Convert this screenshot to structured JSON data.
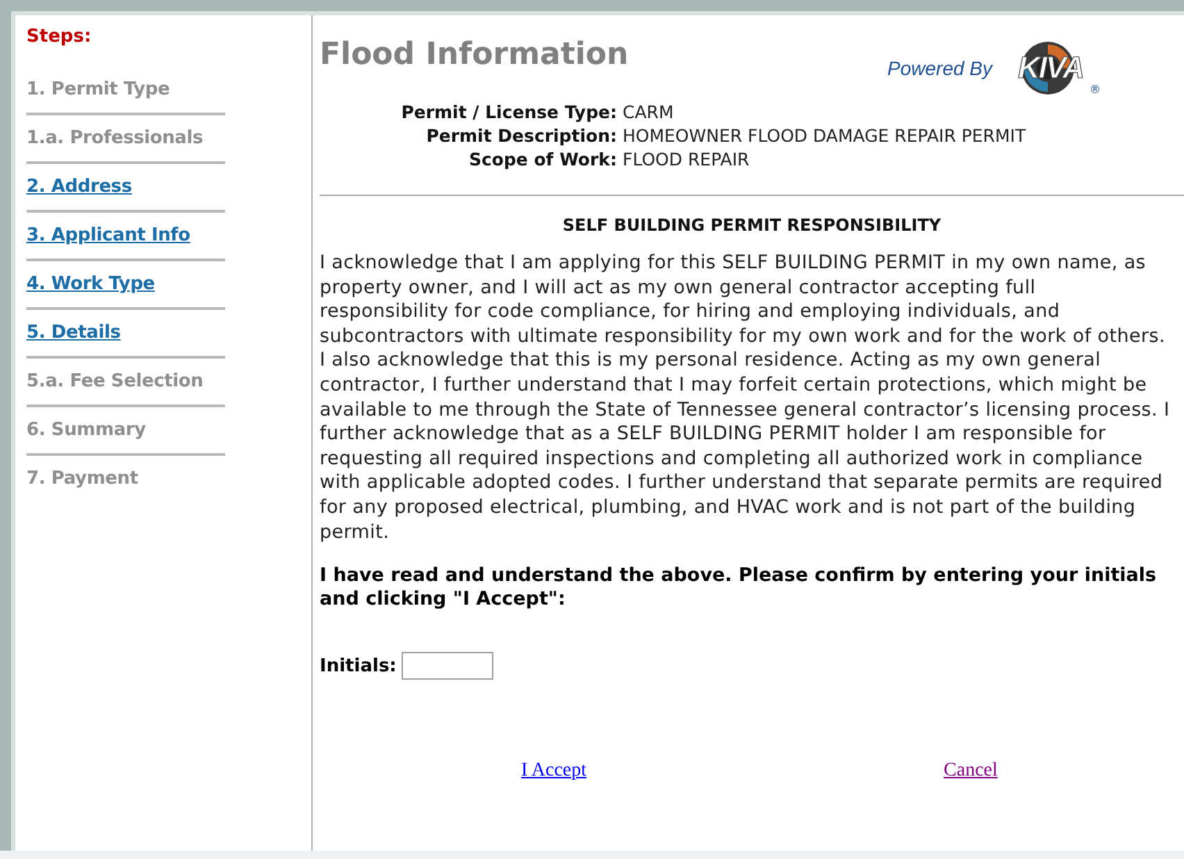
{
  "sidebar": {
    "heading": "Steps:",
    "items": [
      {
        "label": "1. Permit Type",
        "linked": false
      },
      {
        "label": "1.a. Professionals",
        "linked": false
      },
      {
        "label": "2. Address",
        "linked": true
      },
      {
        "label": "3. Applicant Info",
        "linked": true
      },
      {
        "label": "4. Work Type",
        "linked": true
      },
      {
        "label": "5. Details",
        "linked": true
      },
      {
        "label": "5.a. Fee Selection",
        "linked": false
      },
      {
        "label": "6. Summary",
        "linked": false
      },
      {
        "label": "7. Payment",
        "linked": false
      }
    ]
  },
  "header": {
    "title": "Flood Information",
    "powered_by": "Powered By",
    "logo_text": "KIVA",
    "logo_mark": "®"
  },
  "details": [
    {
      "label": "Permit / License Type:",
      "value": "CARM"
    },
    {
      "label": "Permit Description:",
      "value": "HOMEOWNER FLOOD DAMAGE REPAIR PERMIT"
    },
    {
      "label": "Scope of Work:",
      "value": "FLOOD REPAIR"
    }
  ],
  "agreement": {
    "heading": "SELF BUILDING PERMIT RESPONSIBILITY",
    "text": "I acknowledge that I am applying for this SELF BUILDING PERMIT in my own name, as property owner, and I will act as my own general contractor accepting full responsibility for code compliance, for hiring and employing individuals, and subcontractors with ultimate responsibility for my own work and for the work of others. I also acknowledge that this is my personal residence. Acting as my own general contractor, I further understand that I may forfeit certain protections, which might be available to me through the State of Tennessee general contractor’s licensing process. I further acknowledge that as a SELF BUILDING PERMIT holder I am responsible for requesting all required inspections and completing all authorized work in compliance with applicable adopted codes. I further understand that separate permits are required for any proposed electrical, plumbing, and HVAC work and is not part of the building permit.",
    "confirm": "I have read and understand the above. Please confirm by entering your initials and clicking \"I Accept\":"
  },
  "initials": {
    "label": "Initials:"
  },
  "actions": [
    {
      "label": "I Accept",
      "visited": false
    },
    {
      "label": "Cancel",
      "visited": true
    }
  ]
}
